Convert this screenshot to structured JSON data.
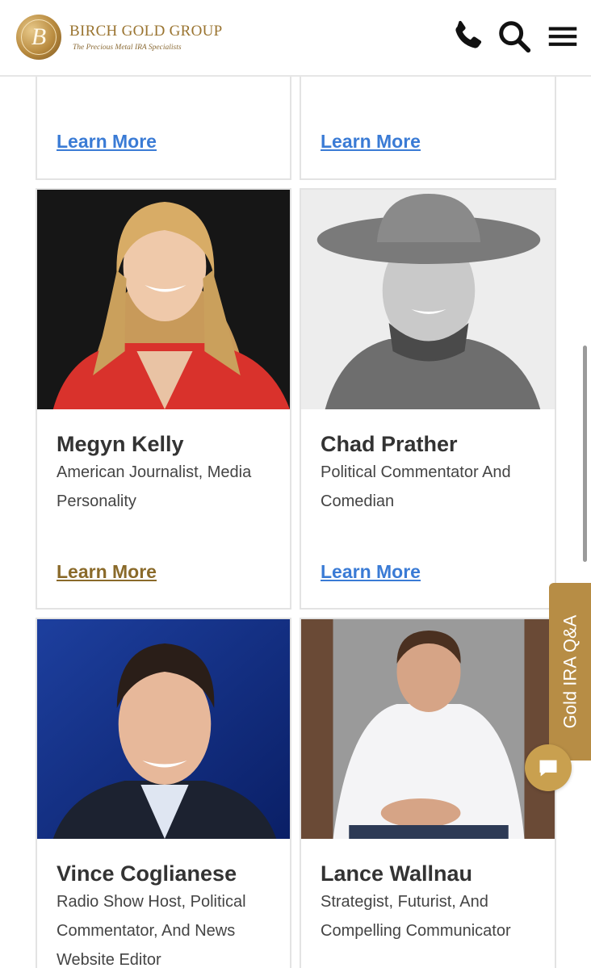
{
  "brand": {
    "name": "BIRCH GOLD GROUP",
    "tagline": "The Precious Metal IRA Specialists",
    "badge_letter": "B"
  },
  "header_icons": [
    "phone-icon",
    "search-icon",
    "menu-icon"
  ],
  "colors": {
    "gold": "#b78d45",
    "link": "#3a7bd5",
    "link_active": "#8a6a2a",
    "card_border": "#e3e3e3"
  },
  "top_cards": [
    {
      "learn_more": "Learn More"
    },
    {
      "learn_more": "Learn More"
    }
  ],
  "cards": [
    {
      "name": "Megyn Kelly",
      "description": "American Journalist, Media Personality",
      "learn_more": "Learn More"
    },
    {
      "name": "Chad Prather",
      "description": "Political Commentator And Comedian",
      "learn_more": "Learn More"
    },
    {
      "name": "Vince Coglianese",
      "description": "Radio Show Host, Political Commentator, And News Website Editor",
      "learn_more": ""
    },
    {
      "name": "Lance Wallnau",
      "description": "Strategist, Futurist, And Compelling Communicator",
      "learn_more": ""
    }
  ],
  "side_tab": {
    "label": "Gold IRA Q&A"
  },
  "chat": {
    "icon": "chat-icon"
  }
}
